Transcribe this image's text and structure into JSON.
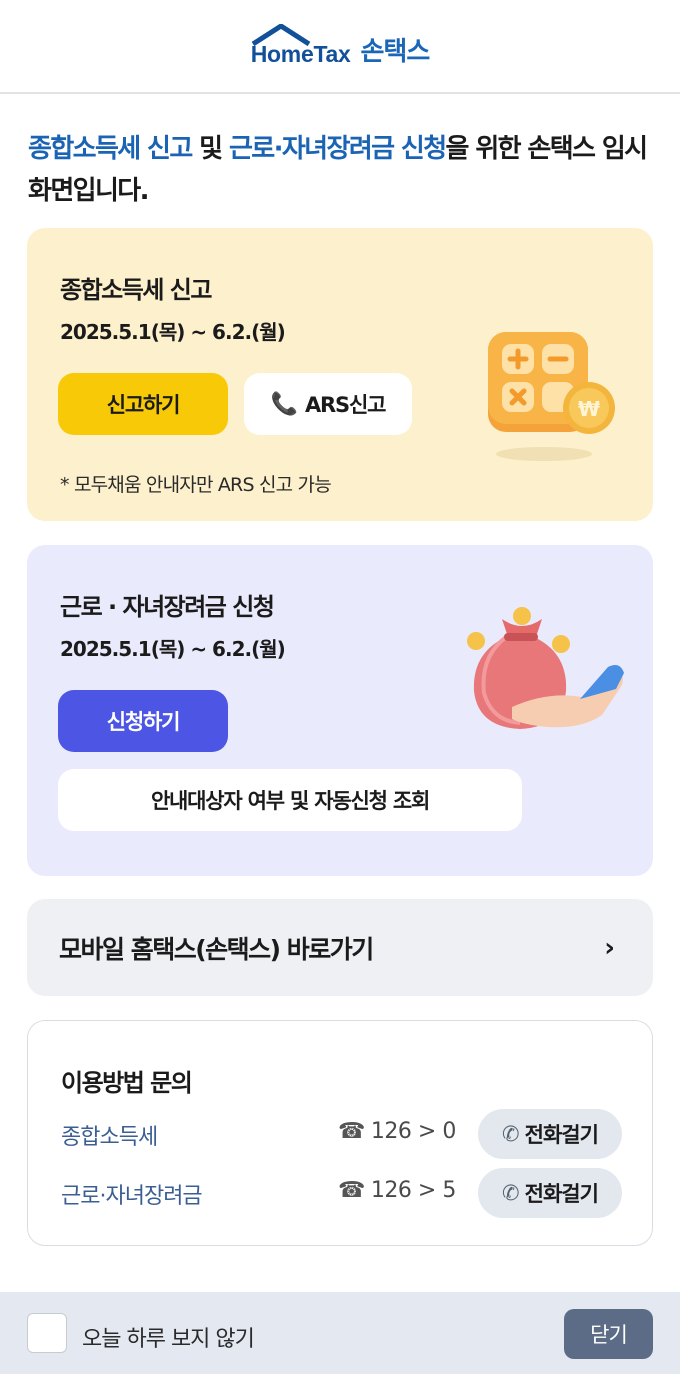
{
  "header": {
    "logo_en": "HomeTax",
    "logo_ko": "손택스"
  },
  "intro": {
    "part1": "종합소득세 신고",
    "part2": " 및 ",
    "part3": "근로·자녀장려금 신청",
    "part4": "을 위한 손택스 임시 화면입니다."
  },
  "tax_card": {
    "title": "종합소득세 신고",
    "date": "2025.5.1(목) ~ 6.2.(월)",
    "primary_button": "신고하기",
    "ars_button": "ARS신고",
    "note": "* 모두채움 안내자만 ARS 신고 가능"
  },
  "labor_card": {
    "title": "근로 · 자녀장려금 신청",
    "date": "2025.5.1(목) ~ 6.2.(월)",
    "primary_button": "신청하기",
    "lookup_button": "안내대상자 여부 및 자동신청 조회"
  },
  "mobile_link": {
    "label": "모바일 홈택스(손택스) 바로가기",
    "chevron": "›"
  },
  "inquiry": {
    "title": "이용방법 문의",
    "rows": [
      {
        "name": "종합소득세",
        "number": "126 > 0",
        "button": "전화걸기"
      },
      {
        "name": "근로·자녀장려금",
        "number": "126 > 5",
        "button": "전화걸기"
      }
    ]
  },
  "footer": {
    "checkbox_label": "오늘 하루 보지 않기",
    "close_button": "닫기"
  },
  "colors": {
    "brand_blue": "#1b64b3",
    "tax_card_bg": "#fdf0cd",
    "labor_card_bg": "#e9ebfc",
    "yellow_button": "#f8c907",
    "blue_button": "#4d55e5",
    "footer_bg": "#e4e9f1",
    "close_button": "#5c6c86"
  }
}
